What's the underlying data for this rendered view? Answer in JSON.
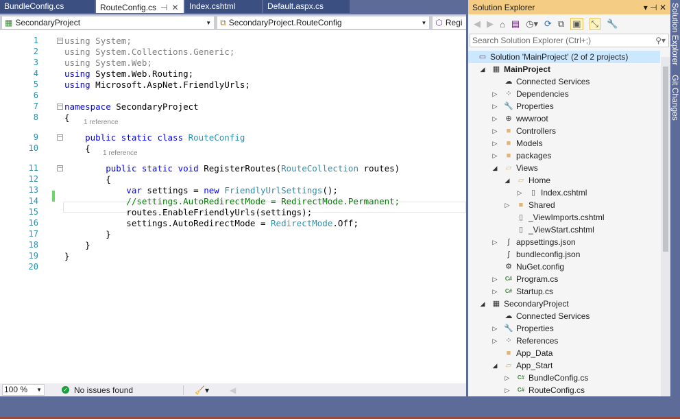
{
  "tabs": [
    {
      "label": "BundleConfig.cs"
    },
    {
      "label": "RouteConfig.cs",
      "active": true
    },
    {
      "label": "Index.cshtml"
    },
    {
      "label": "Default.aspx.cs"
    }
  ],
  "navbar": {
    "project": "SecondaryProject",
    "class": "SecondaryProject.RouteConfig",
    "member": "Regi"
  },
  "editor": {
    "lines": [
      {
        "n": "1",
        "toks": [
          [
            "using",
            "g"
          ],
          [
            " System;",
            "g"
          ]
        ]
      },
      {
        "n": "2",
        "toks": [
          [
            "using System.Collections.Generic;",
            "g"
          ]
        ]
      },
      {
        "n": "3",
        "toks": [
          [
            "using System.Web;",
            "g"
          ]
        ]
      },
      {
        "n": "4",
        "toks": [
          [
            "using",
            "k"
          ],
          [
            " System.Web.Routing;",
            ""
          ]
        ]
      },
      {
        "n": "5",
        "toks": [
          [
            "using",
            "k"
          ],
          [
            " Microsoft.AspNet.FriendlyUrls;",
            ""
          ]
        ]
      },
      {
        "n": "6",
        "toks": []
      },
      {
        "n": "7",
        "toks": [
          [
            "namespace",
            "k"
          ],
          [
            " SecondaryProject",
            ""
          ]
        ]
      },
      {
        "n": "8",
        "toks": [
          [
            "{",
            ""
          ]
        ]
      },
      {
        "n": "9",
        "toks": [
          [
            "    public static class ",
            "k"
          ],
          [
            "RouteConfig",
            "t"
          ]
        ]
      },
      {
        "n": "10",
        "toks": [
          [
            "    {",
            ""
          ]
        ]
      },
      {
        "n": "11",
        "toks": [
          [
            "        public static void ",
            "k"
          ],
          [
            "RegisterRoutes(",
            ""
          ],
          [
            "RouteCollection",
            "t"
          ],
          [
            " routes)",
            ""
          ]
        ]
      },
      {
        "n": "12",
        "toks": [
          [
            "        {",
            ""
          ]
        ]
      },
      {
        "n": "13",
        "toks": [
          [
            "            var",
            "k"
          ],
          [
            " settings = ",
            ""
          ],
          [
            "new ",
            "k"
          ],
          [
            "FriendlyUrlSettings",
            "t"
          ],
          [
            "();",
            ""
          ]
        ]
      },
      {
        "n": "14",
        "toks": [
          [
            "            //settings.AutoRedirectMode = RedirectMode.Permanent;",
            "c"
          ]
        ]
      },
      {
        "n": "15",
        "toks": [
          [
            "            routes.EnableFriendlyUrls(settings);",
            ""
          ]
        ]
      },
      {
        "n": "16",
        "toks": [
          [
            "            settings.AutoRedirectMode = ",
            ""
          ],
          [
            "RedirectMode",
            "t"
          ],
          [
            ".Off;",
            ""
          ]
        ]
      },
      {
        "n": "17",
        "toks": [
          [
            "        }",
            ""
          ]
        ]
      },
      {
        "n": "18",
        "toks": [
          [
            "    }",
            ""
          ]
        ]
      },
      {
        "n": "19",
        "toks": [
          [
            "}",
            ""
          ]
        ]
      },
      {
        "n": "20",
        "toks": []
      }
    ],
    "codelens": "1 reference"
  },
  "status": {
    "zoom": "100 %",
    "issues": "No issues found"
  },
  "solution_explorer": {
    "title": "Solution Explorer",
    "search_placeholder": "Search Solution Explorer (Ctrl+;)",
    "items": [
      {
        "label": "Solution 'MainProject' (2 of 2 projects)",
        "level": 0,
        "arrow": "",
        "icon": "solution-icon",
        "selected": true
      },
      {
        "label": "MainProject",
        "level": 1,
        "arrow": "open",
        "icon": "project-icon",
        "bold": true
      },
      {
        "label": "Connected Services",
        "level": 2,
        "arrow": "",
        "icon": "connected-services-icon"
      },
      {
        "label": "Dependencies",
        "level": 2,
        "arrow": "closed",
        "icon": "dependencies-icon"
      },
      {
        "label": "Properties",
        "level": 2,
        "arrow": "closed",
        "icon": "wrench-icon"
      },
      {
        "label": "wwwroot",
        "level": 2,
        "arrow": "closed",
        "icon": "globe-icon"
      },
      {
        "label": "Controllers",
        "level": 2,
        "arrow": "closed",
        "icon": "folder-icon"
      },
      {
        "label": "Models",
        "level": 2,
        "arrow": "closed",
        "icon": "folder-icon"
      },
      {
        "label": "packages",
        "level": 2,
        "arrow": "closed",
        "icon": "folder-icon"
      },
      {
        "label": "Views",
        "level": 2,
        "arrow": "open",
        "icon": "folder-open-icon"
      },
      {
        "label": "Home",
        "level": 3,
        "arrow": "open",
        "icon": "folder-open-icon"
      },
      {
        "label": "Index.cshtml",
        "level": 4,
        "arrow": "closed",
        "icon": "file-icon"
      },
      {
        "label": "Shared",
        "level": 3,
        "arrow": "closed",
        "icon": "folder-icon"
      },
      {
        "label": "_ViewImports.cshtml",
        "level": 3,
        "arrow": "",
        "icon": "file-icon"
      },
      {
        "label": "_ViewStart.cshtml",
        "level": 3,
        "arrow": "",
        "icon": "file-icon"
      },
      {
        "label": "appsettings.json",
        "level": 2,
        "arrow": "closed",
        "icon": "json-icon"
      },
      {
        "label": "bundleconfig.json",
        "level": 2,
        "arrow": "",
        "icon": "json-icon"
      },
      {
        "label": "NuGet.config",
        "level": 2,
        "arrow": "",
        "icon": "config-icon"
      },
      {
        "label": "Program.cs",
        "level": 2,
        "arrow": "closed",
        "icon": "csharp-icon"
      },
      {
        "label": "Startup.cs",
        "level": 2,
        "arrow": "closed",
        "icon": "csharp-icon"
      },
      {
        "label": "SecondaryProject",
        "level": 1,
        "arrow": "open",
        "icon": "project-icon"
      },
      {
        "label": "Connected Services",
        "level": 2,
        "arrow": "",
        "icon": "connected-services-icon"
      },
      {
        "label": "Properties",
        "level": 2,
        "arrow": "closed",
        "icon": "wrench-icon"
      },
      {
        "label": "References",
        "level": 2,
        "arrow": "closed",
        "icon": "dependencies-icon"
      },
      {
        "label": "App_Data",
        "level": 2,
        "arrow": "",
        "icon": "folder-icon"
      },
      {
        "label": "App_Start",
        "level": 2,
        "arrow": "open",
        "icon": "folder-open-icon"
      },
      {
        "label": "BundleConfig.cs",
        "level": 3,
        "arrow": "closed",
        "icon": "csharp-icon"
      },
      {
        "label": "RouteConfig.cs",
        "level": 3,
        "arrow": "closed",
        "icon": "csharp-icon"
      }
    ]
  },
  "side_tabs": {
    "solution_explorer": "Solution Explorer",
    "git_changes": "Git Changes"
  }
}
